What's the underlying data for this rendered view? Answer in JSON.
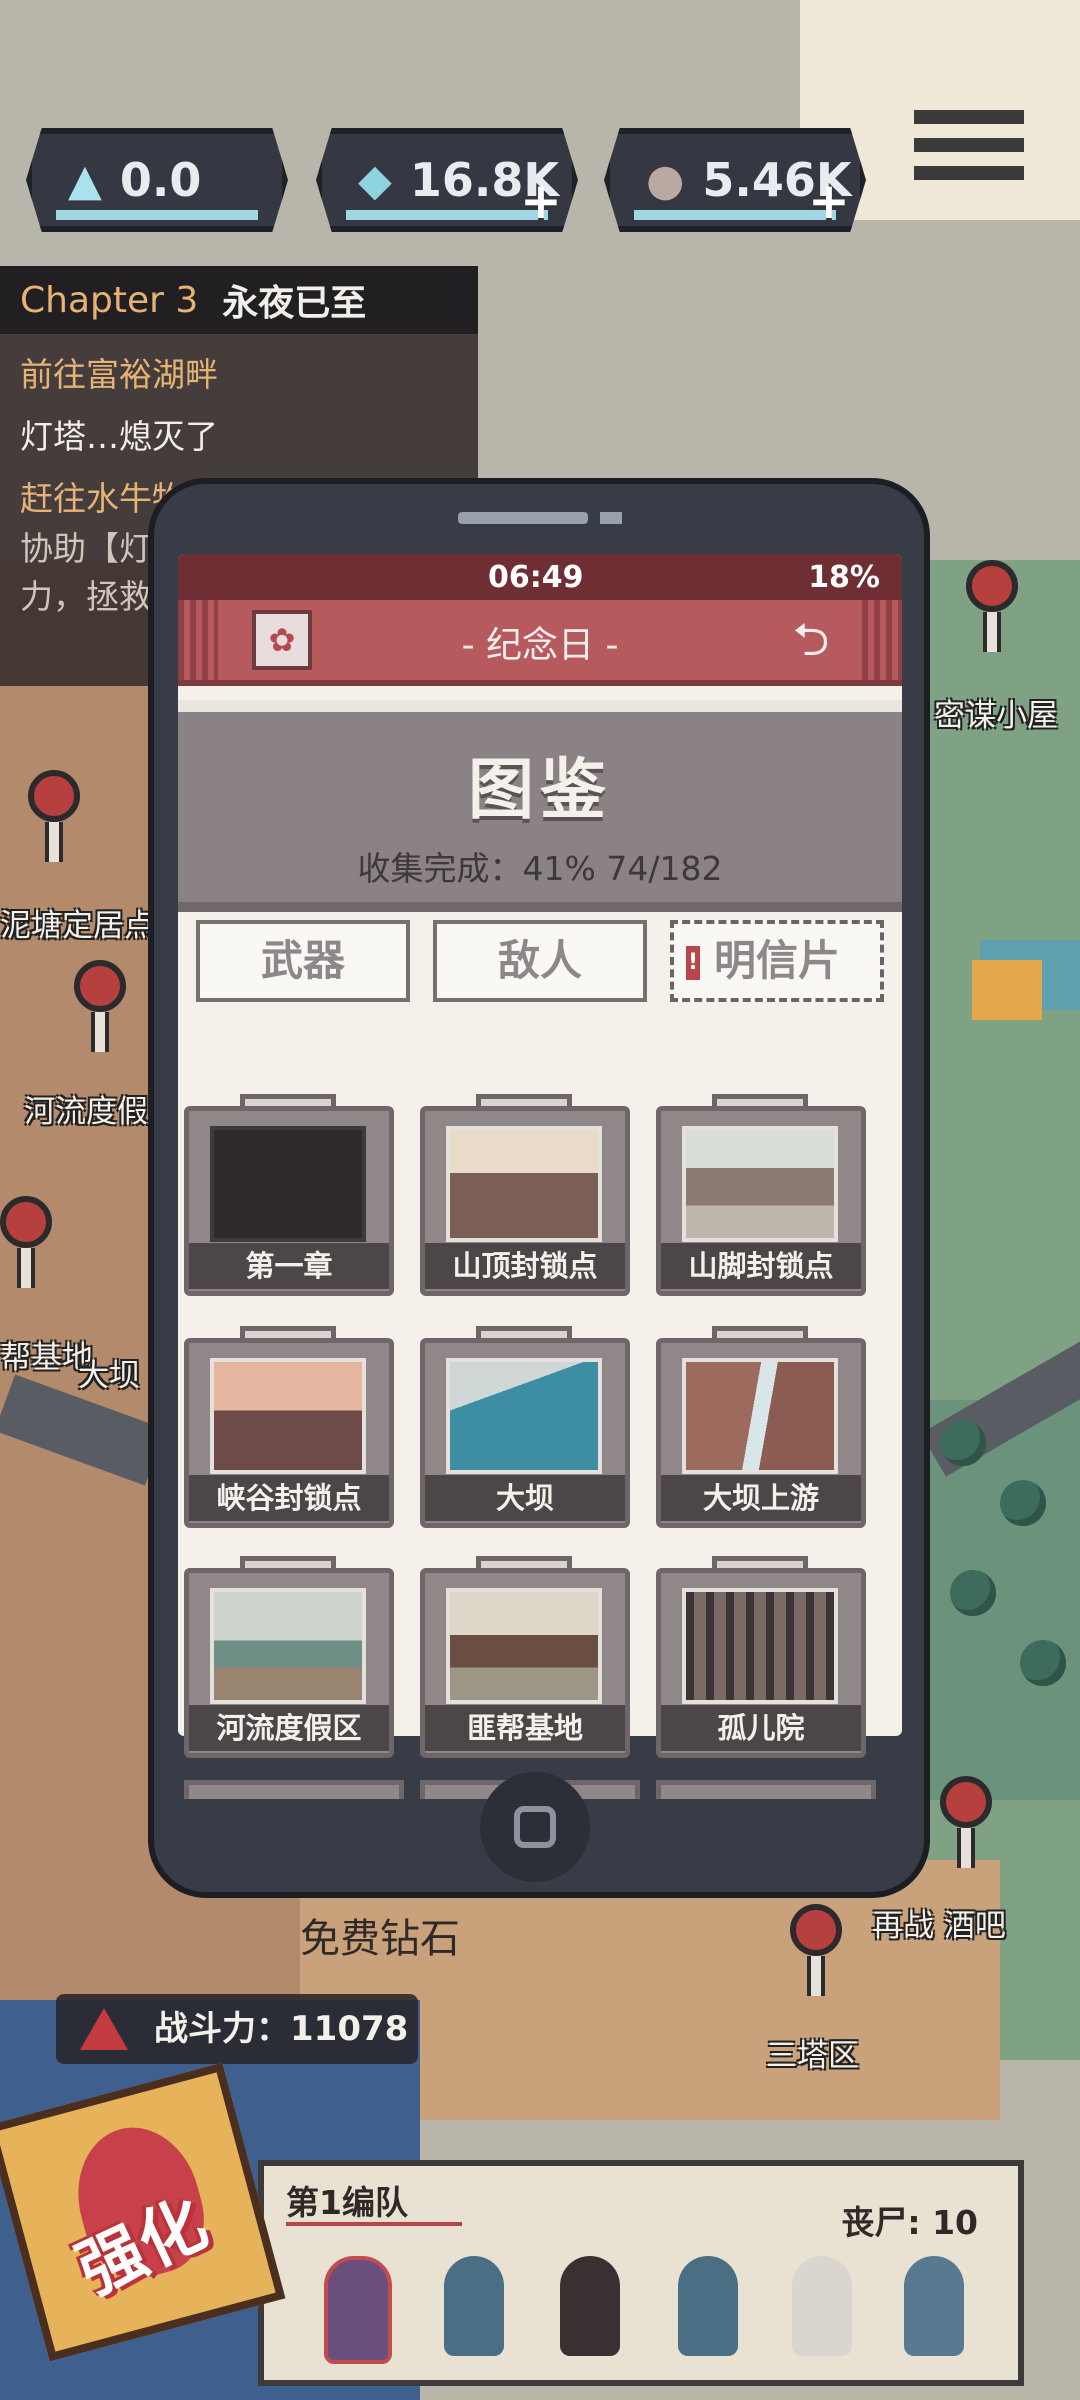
{
  "resources": [
    {
      "icon": "crystal-icon",
      "value": "0.0",
      "has_plus": false
    },
    {
      "icon": "parts-icon",
      "value": "16.8K",
      "has_plus": true
    },
    {
      "icon": "ore-icon",
      "value": "5.46K",
      "has_plus": true
    }
  ],
  "quest": {
    "chapter": "Chapter 3",
    "title": "永夜已至",
    "lines": [
      {
        "text": "前往富裕湖畔",
        "tone": "gold"
      },
      {
        "text": "灯塔…熄灭了",
        "tone": "white"
      },
      {
        "text": "赶往水牛牧",
        "tone": "gold"
      },
      {
        "text": "协助【灯",
        "tone": "dim"
      },
      {
        "text": "力，拯救",
        "tone": "dim"
      }
    ]
  },
  "locations": {
    "secret_hut": "密谋小屋",
    "mud_pond": "泥塘定居点",
    "river_resort": "河流度假",
    "gang_base": "帮基地",
    "dam": "大坝",
    "bar": "再战   酒吧",
    "three_tower": "三塔区"
  },
  "phone": {
    "time": "06:49",
    "battery": "18%",
    "app_title": "- 纪念日 -",
    "header_title": "图鉴",
    "progress": "收集完成：41%  74/182",
    "tabs": [
      {
        "label": "武器",
        "active": false
      },
      {
        "label": "敌人",
        "active": false
      },
      {
        "label": "明信片",
        "active": true,
        "badge": "!"
      }
    ],
    "cards": [
      {
        "label": "第一章",
        "scene": "blank"
      },
      {
        "label": "山顶封锁点",
        "scene": "mountain"
      },
      {
        "label": "山脚封锁点",
        "scene": "base"
      },
      {
        "label": "峡谷封锁点",
        "scene": "canyon"
      },
      {
        "label": "大坝",
        "scene": "dam"
      },
      {
        "label": "大坝上游",
        "scene": "upstream"
      },
      {
        "label": "河流度假区",
        "scene": "camp"
      },
      {
        "label": "匪帮基地",
        "scene": "barn"
      },
      {
        "label": "孤儿院",
        "scene": "gate"
      }
    ]
  },
  "bottom": {
    "free_diamond": "免费钻石",
    "power": "战斗力：11078",
    "enhance": "强化",
    "team_name": "第1编队",
    "zombie_count": "丧尸: 10"
  }
}
